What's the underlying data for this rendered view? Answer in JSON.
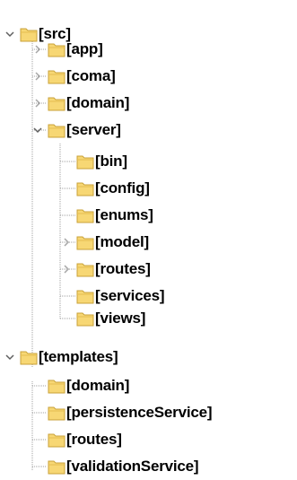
{
  "tree": {
    "nodes": [
      {
        "label": "[src]",
        "depth": 0,
        "state": "expanded"
      },
      {
        "label": "[app]",
        "depth": 1,
        "state": "collapsed"
      },
      {
        "label": "[coma]",
        "depth": 1,
        "state": "collapsed"
      },
      {
        "label": "[domain]",
        "depth": 1,
        "state": "collapsed"
      },
      {
        "label": "[server]",
        "depth": 1,
        "state": "expanded"
      },
      {
        "label": "[bin]",
        "depth": 2,
        "state": "leaf"
      },
      {
        "label": "[config]",
        "depth": 2,
        "state": "leaf"
      },
      {
        "label": "[enums]",
        "depth": 2,
        "state": "leaf"
      },
      {
        "label": "[model]",
        "depth": 2,
        "state": "collapsed"
      },
      {
        "label": "[routes]",
        "depth": 2,
        "state": "collapsed"
      },
      {
        "label": "[services]",
        "depth": 2,
        "state": "leaf"
      },
      {
        "label": "[views]",
        "depth": 2,
        "state": "leaf"
      },
      {
        "label": "[templates]",
        "depth": 0,
        "state": "expanded"
      },
      {
        "label": "[domain]",
        "depth": 1,
        "state": "leaf"
      },
      {
        "label": "[persistenceService]",
        "depth": 1,
        "state": "leaf"
      },
      {
        "label": "[routes]",
        "depth": 1,
        "state": "leaf"
      },
      {
        "label": "[validationService]",
        "depth": 1,
        "state": "leaf"
      }
    ]
  },
  "colors": {
    "folder_fill": "#f7d774",
    "folder_edge": "#c9a238",
    "expander": "#606060",
    "collapsed_expander": "#a6a6a6",
    "guide_line": "#a0a0a0"
  },
  "icons": {
    "folder": "folder-icon",
    "expanded": "chevron-down-icon",
    "collapsed": "chevron-right-icon"
  }
}
